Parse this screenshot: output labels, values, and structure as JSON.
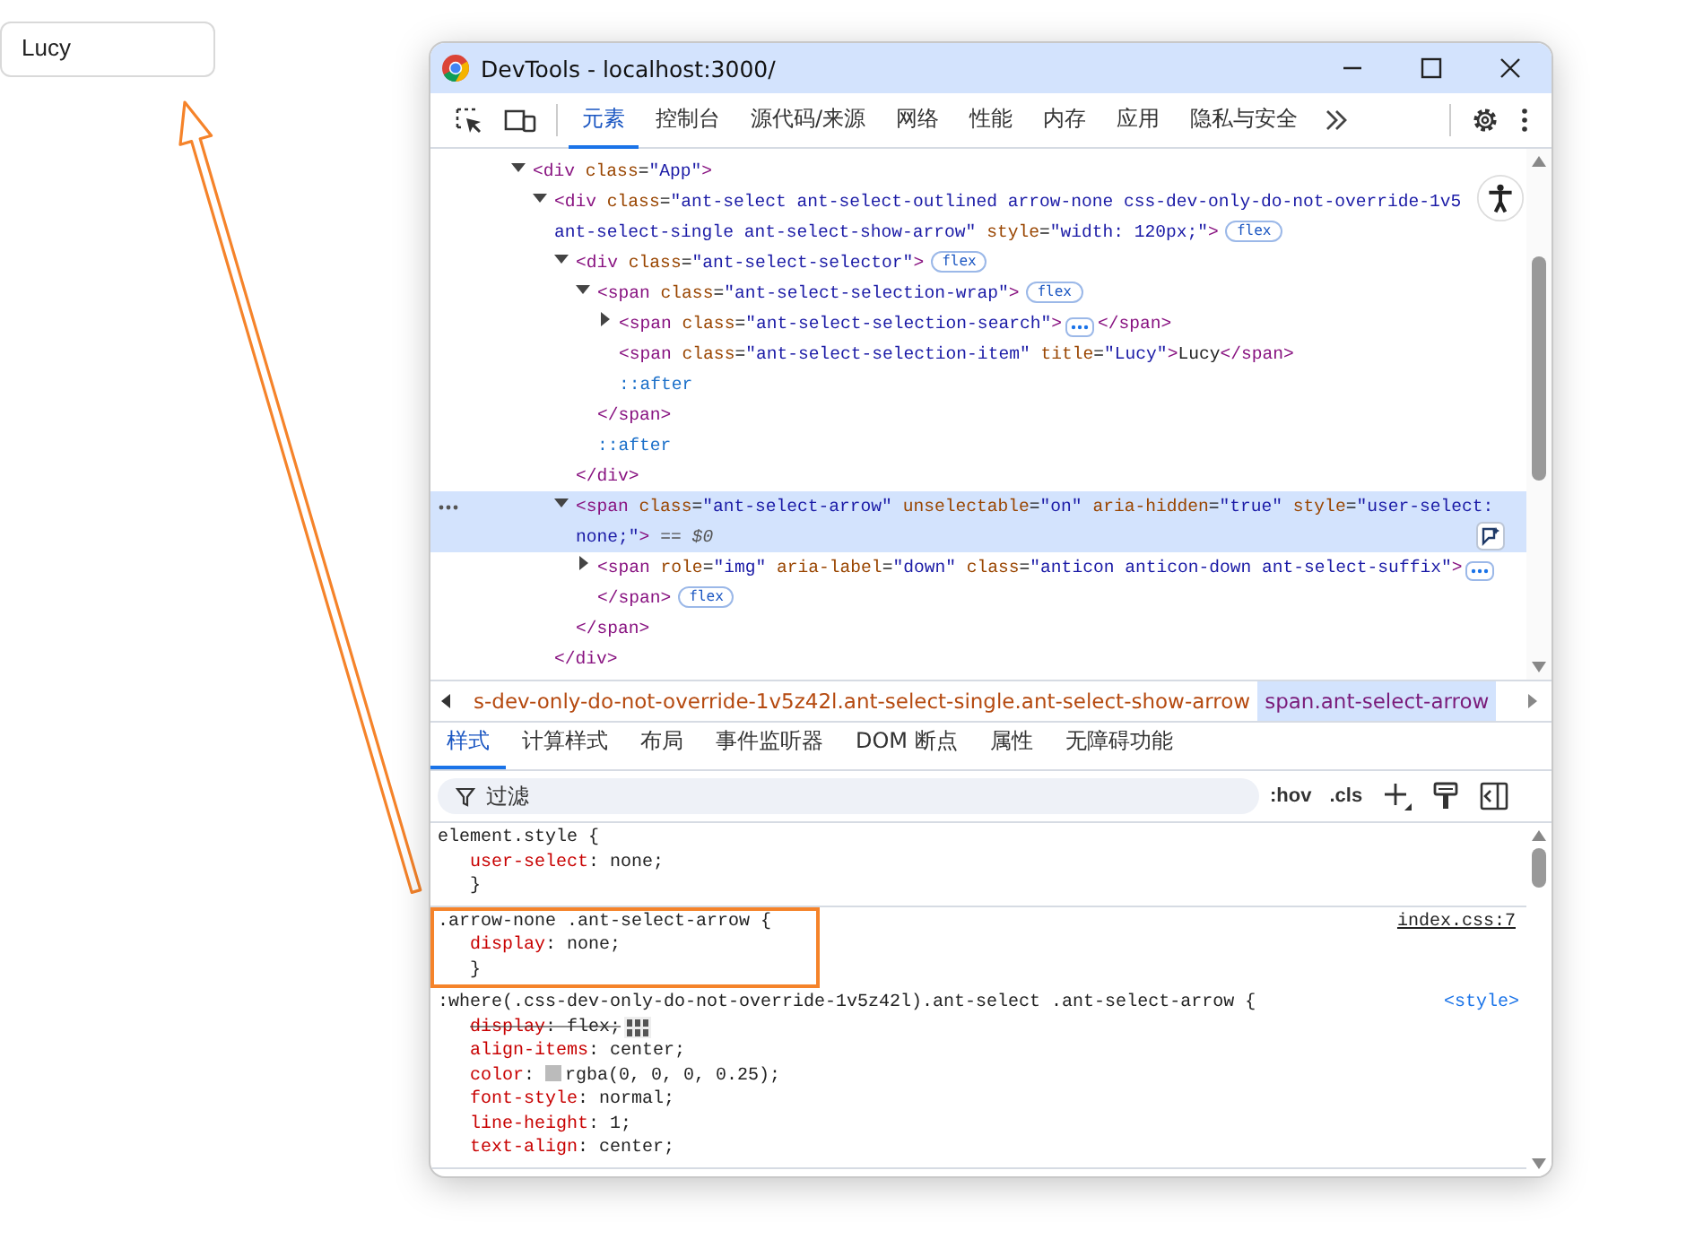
{
  "page": {
    "select": {
      "value": "Lucy"
    }
  },
  "devtools": {
    "title": "DevTools - localhost:3000/",
    "tabs": [
      {
        "label": "元素",
        "selected": true
      },
      {
        "label": "控制台",
        "selected": false
      },
      {
        "label": "源代码/来源",
        "selected": false
      },
      {
        "label": "网络",
        "selected": false
      },
      {
        "label": "性能",
        "selected": false
      },
      {
        "label": "内存",
        "selected": false
      },
      {
        "label": "应用",
        "selected": false
      },
      {
        "label": "隐私与安全",
        "selected": false
      }
    ],
    "dom_tree": [
      {
        "kind": "element",
        "text": "<div class=\"App\">",
        "expanded": true,
        "selected": false,
        "children": [
          {
            "kind": "element",
            "text": "<div class=\"ant-select ant-select-outlined arrow-none css-dev-only-do-not-override-1v5\nant-select-single ant-select-show-arrow\" style=\"width: 120px;\">",
            "badge": "flex",
            "expanded": true,
            "selected": false,
            "close": "</div>",
            "children": [
              {
                "kind": "element",
                "text": "<div class=\"ant-select-selector\">",
                "badge": "flex",
                "expanded": true,
                "selected": false,
                "close": "</div>",
                "children": [
                  {
                    "kind": "element",
                    "text": "<span class=\"ant-select-selection-wrap\">",
                    "badge": "flex",
                    "expanded": true,
                    "selected": false,
                    "close": "</span>",
                    "children": [
                      {
                        "kind": "element",
                        "text": "<span class=\"ant-select-selection-search\">",
                        "expanded": false,
                        "ellipsis": true,
                        "close": "</span>",
                        "selected": false
                      },
                      {
                        "kind": "element",
                        "text": "<span class=\"ant-select-selection-item\" title=\"Lucy\">Lucy</span>",
                        "selected": false
                      },
                      {
                        "kind": "pseudo",
                        "text": "::after",
                        "selected": false
                      }
                    ]
                  },
                  {
                    "kind": "pseudo",
                    "text": "::after",
                    "selected": false
                  }
                ]
              },
              {
                "kind": "element",
                "text": "<span class=\"ant-select-arrow\" unselectable=\"on\" aria-hidden=\"true\" style=\"user-select:\nnone;\">",
                "marker": "== $0",
                "expanded": true,
                "selected": true,
                "close": "</span>",
                "children": [
                  {
                    "kind": "element",
                    "text": "<span role=\"img\" aria-label=\"down\" class=\"anticon anticon-down ant-select-suffix\">",
                    "expanded": false,
                    "ellipsis": true,
                    "close": "</span>",
                    "badge": "flex",
                    "selected": false
                  }
                ]
              }
            ]
          }
        ]
      }
    ],
    "breadcrumbs": [
      {
        "label": "s-dev-only-do-not-override-1v5z42l.ant-select-single.ant-select-show-arrow",
        "selected": false
      },
      {
        "label": "span.ant-select-arrow",
        "selected": true
      }
    ],
    "style_tabs": [
      {
        "label": "样式",
        "selected": true
      },
      {
        "label": "计算样式",
        "selected": false
      },
      {
        "label": "布局",
        "selected": false
      },
      {
        "label": "事件监听器",
        "selected": false
      },
      {
        "label": "DOM 断点",
        "selected": false
      },
      {
        "label": "属性",
        "selected": false
      },
      {
        "label": "无障碍功能",
        "selected": false
      }
    ],
    "filter": {
      "placeholder": "过滤"
    },
    "style_buttons": [
      ":hov",
      ".cls"
    ],
    "rules": [
      {
        "selector": "element.style {",
        "highlighted": false,
        "close": "}",
        "props": [
          {
            "text": "user-select: none;",
            "kind": "plain",
            "overridden": false
          }
        ]
      },
      {
        "selector": ".arrow-none .ant-select-arrow {",
        "source": "index.css:7",
        "highlighted": true,
        "close": "}",
        "props": [
          {
            "text": "display: none;",
            "kind": "plain",
            "overridden": false
          }
        ]
      },
      {
        "selector": ":where(.css-dev-only-do-not-override-1v5z42l).ant-select .ant-select-arrow {",
        "source": "<style>",
        "highlighted": false,
        "props": [
          {
            "text": "display: flex;",
            "kind": "flex",
            "overridden": true
          },
          {
            "text": "align-items: center;",
            "kind": "plain",
            "overridden": false
          },
          {
            "text": "color: rgba(0, 0, 0, 0.25);",
            "kind": "color",
            "overridden": false
          },
          {
            "text": "font-style: normal;",
            "kind": "plain",
            "overridden": false
          },
          {
            "text": "line-height: 1;",
            "kind": "plain",
            "overridden": false
          },
          {
            "text": "text-align: center;",
            "kind": "plain",
            "overridden": false
          }
        ]
      }
    ]
  }
}
